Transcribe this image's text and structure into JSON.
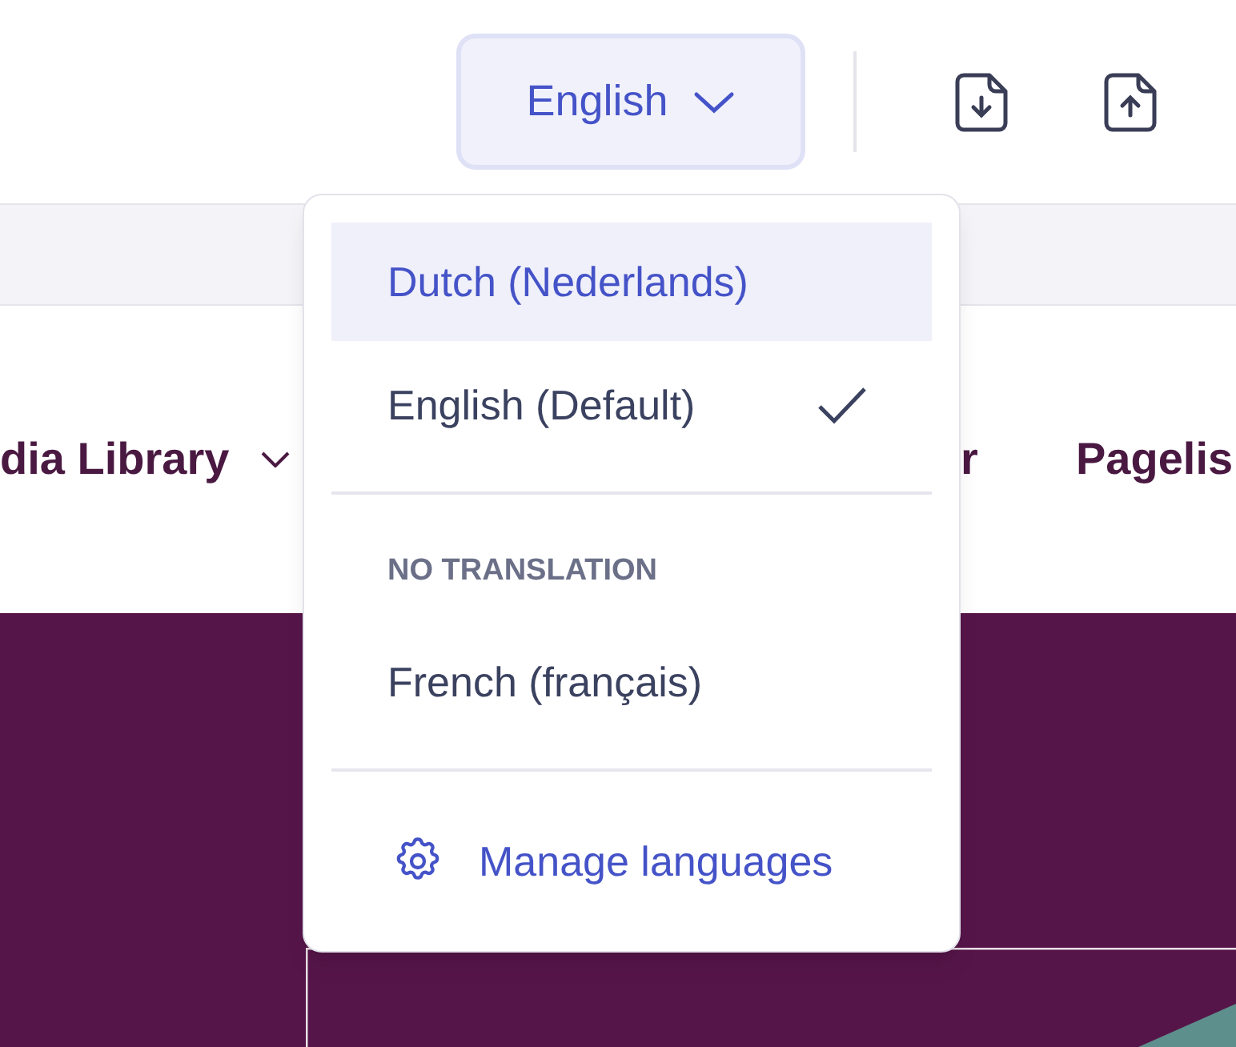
{
  "language_button": {
    "label": "English"
  },
  "nav_items": [
    {
      "label": "dia Library",
      "has_dropdown": true
    },
    {
      "label": "r",
      "has_dropdown": false
    },
    {
      "label": "Pagelis",
      "has_dropdown": false
    }
  ],
  "language_menu": {
    "sections": [
      {
        "items": [
          {
            "label": "Dutch (Nederlands)",
            "highlighted": true,
            "checked": false
          },
          {
            "label": "English (Default)",
            "highlighted": false,
            "checked": true
          }
        ]
      },
      {
        "heading": "NO TRANSLATION",
        "items": [
          {
            "label": "French (français)",
            "highlighted": false,
            "checked": false
          }
        ]
      }
    ],
    "footer_link": "Manage languages"
  }
}
